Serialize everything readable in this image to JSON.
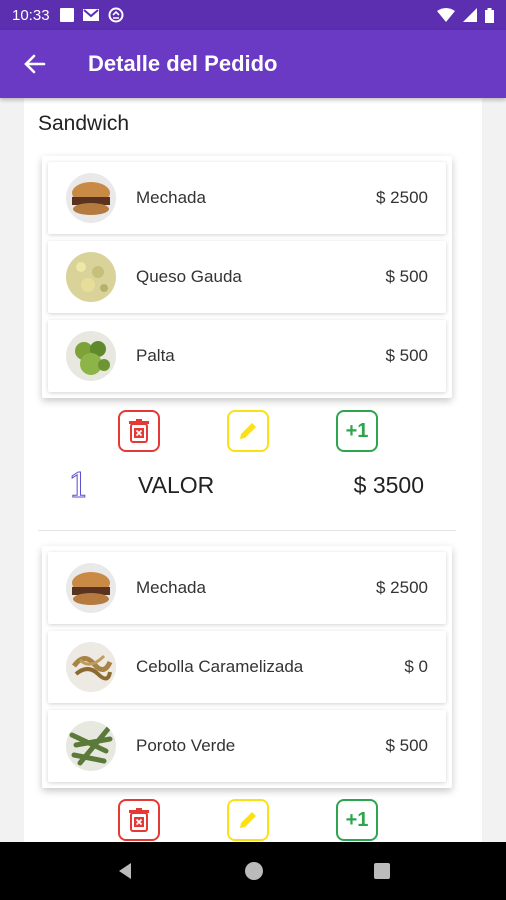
{
  "status_bar": {
    "time": "10:33"
  },
  "app_bar": {
    "title": "Detalle del Pedido"
  },
  "section": {
    "title": "Sandwich"
  },
  "orders": [
    {
      "items": [
        {
          "name": "Mechada",
          "price": "$ 2500",
          "icon": "meat-sandwich"
        },
        {
          "name": "Queso Gauda",
          "price": "$ 500",
          "icon": "cheese"
        },
        {
          "name": "Palta",
          "price": "$ 500",
          "icon": "avocado"
        }
      ],
      "quantity": "1",
      "total_label": "VALOR",
      "total_amount": "$ 3500"
    },
    {
      "items": [
        {
          "name": "Mechada",
          "price": "$ 2500",
          "icon": "meat-sandwich"
        },
        {
          "name": "Cebolla Caramelizada",
          "price": "$ 0",
          "icon": "onion"
        },
        {
          "name": "Poroto Verde",
          "price": "$ 500",
          "icon": "green-beans"
        }
      ],
      "actions": {
        "plus_label": "+1"
      }
    }
  ],
  "action_labels": {
    "plus": "+1"
  },
  "colors": {
    "primary": "#6a3ac4",
    "status_bar": "#5b2fb0",
    "delete": "#e53935",
    "edit": "#fbe016",
    "add": "#2ea44f"
  }
}
